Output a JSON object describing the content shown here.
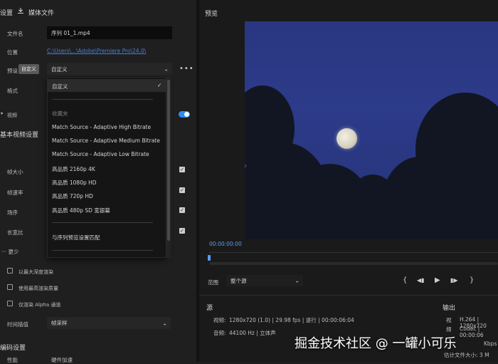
{
  "left_panel": {
    "settings_tab": "设置",
    "media_file_tab": "媒体文件",
    "file_name_label": "文件名",
    "file_name_value": "序列 01_1.mp4",
    "location_label": "位置",
    "location_path": "C:\\Users\\...\\Adobe\\Premiere Pro\\24.0\\",
    "preset_label": "预设",
    "preset_tooltip": "自定义",
    "preset_value": "自定义",
    "format_label": "格式",
    "video_section": "视频",
    "basic_video_settings": "基本视频设置",
    "frame_size_label": "帧大小",
    "frame_rate_label": "帧速率",
    "field_order_label": "场序",
    "aspect_label": "长宽比",
    "more_less": "更少",
    "render_max_depth": "以最大深度渲染",
    "use_max_render_quality": "使用最高渲染质量",
    "render_alpha_only": "仅渲染 Alpha 通道",
    "time_interpolation_label": "时间插值",
    "time_interpolation_value": "帧采样",
    "encoding_settings": "编码设置",
    "performance_label": "性能",
    "performance_value": "硬件加速"
  },
  "dropdown": {
    "selected": "自定义",
    "check": "✓",
    "group_favorites": "收藏夹",
    "items": [
      "Match Source - Adaptive High Bitrate",
      "Match Source - Adaptive Medium Bitrate",
      "Match Source - Adaptive Low Bitrate",
      "高品质 2160p 4K",
      "高品质 1080p HD",
      "高品质 720p HD",
      "高品质 480p SD 宽银幕"
    ],
    "match_sequence": "与序列预览设置匹配"
  },
  "preview": {
    "title": "预览",
    "timecode": "00:00:00:00",
    "range_label": "范围",
    "range_value": "整个源",
    "controls": {
      "mark_in": "{",
      "step_back": "◀▮",
      "play": "▶",
      "step_fwd": "▮▶",
      "mark_out": "}"
    }
  },
  "source": {
    "title": "源",
    "video_label": "视频:",
    "video_value": "1280x720 (1.0) | 29.98 fps | 逐行 | 00:00:06:04",
    "audio_label": "音频:",
    "audio_value": "44100 Hz | 立体声"
  },
  "output": {
    "title": "输出",
    "video_label": "视",
    "video_value": "H.264 | 1280x720",
    "codec_label": "频",
    "codec_value": "Codec | 00:00:06",
    "bitrate_value": "Kbps",
    "estimate_label": "估计文件大小: 3 M"
  },
  "watermark": "掘金技术社区 @ 一罐小可乐",
  "colors": {
    "accent": "#2d8cf0",
    "link": "#4a7ed6",
    "panel": "#1f1f1f",
    "field": "#0c0c0c"
  }
}
